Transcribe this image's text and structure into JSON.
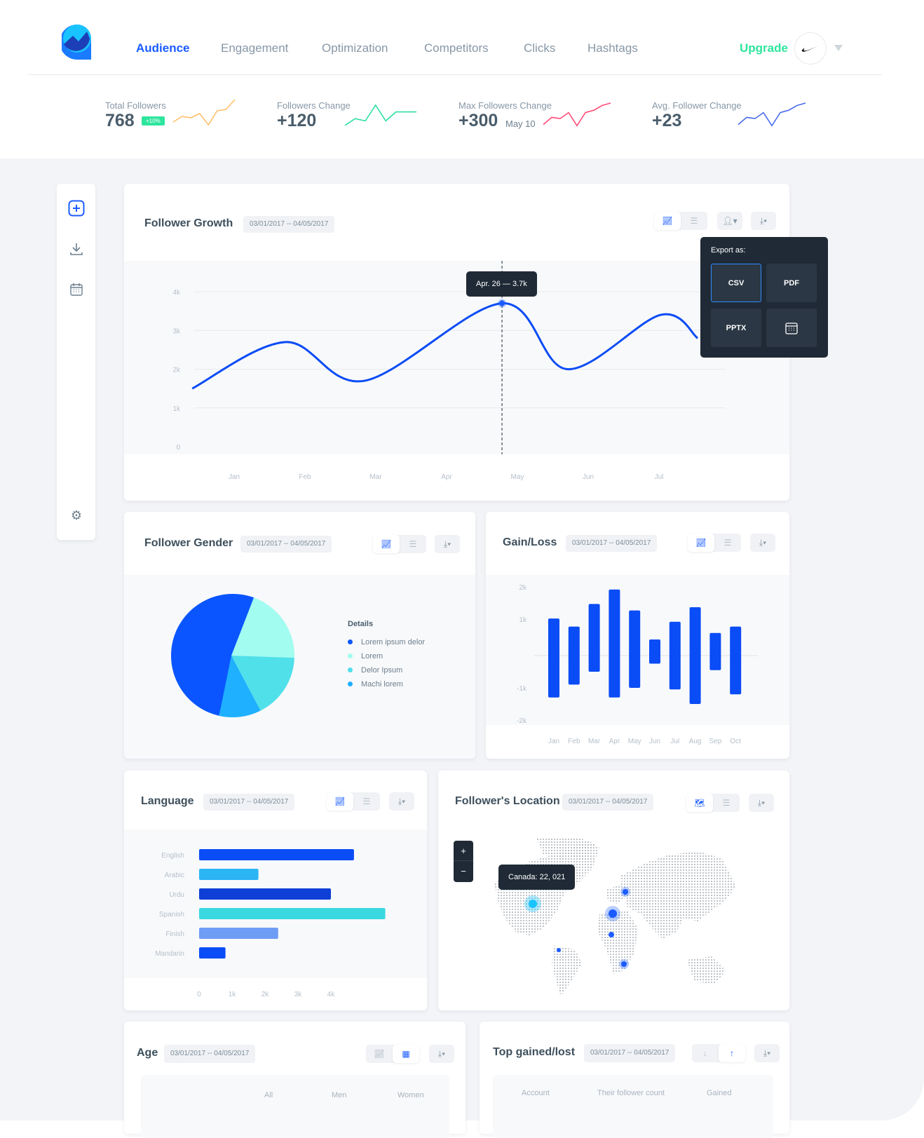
{
  "nav": {
    "items": [
      {
        "label": "Audience",
        "active": true
      },
      {
        "label": "Engagement"
      },
      {
        "label": "Optimization"
      },
      {
        "label": "Competitors"
      },
      {
        "label": "Clicks"
      },
      {
        "label": "Hashtags"
      }
    ],
    "upgrade_label": "Upgrade",
    "colors": {
      "accent": "#1a5cff",
      "upgrade": "#2ee59d"
    }
  },
  "kpis": [
    {
      "label": "Total Followers",
      "value": "768",
      "badge": "+10%",
      "color": "#ffc06b",
      "spark": [
        2,
        4,
        3.5,
        5,
        1,
        6,
        6.5,
        10
      ]
    },
    {
      "label": "Followers Change",
      "value": "+120",
      "color": "#2ee0a0",
      "spark": [
        1,
        4,
        3,
        10,
        3,
        7,
        7,
        7
      ]
    },
    {
      "label": "Max Followers Change",
      "value": "+300",
      "sub": "May 10",
      "color": "#ff4d7a",
      "spark": [
        1,
        4,
        3.5,
        6,
        0.5,
        6,
        7,
        9,
        10
      ]
    },
    {
      "label": "Avg. Follower Change",
      "value": "+23",
      "color": "#4a6cf0",
      "spark": [
        1,
        4,
        3.5,
        6,
        0.5,
        6,
        7,
        9,
        10
      ]
    }
  ],
  "sidebar": {
    "icons": [
      "add-icon",
      "download-icon",
      "calendar-icon",
      "gear-icon"
    ]
  },
  "follower_growth": {
    "title": "Follower Growth",
    "date": "03/01/2017 -- 04/05/2017",
    "tooltip": "Apr. 26  —  3.7k",
    "export": {
      "label": "Export as:",
      "options": [
        "CSV",
        "PDF",
        "PPTX"
      ]
    }
  },
  "follower_gender": {
    "title": "Follower Gender",
    "date": "03/01/2017 -- 04/05/2017",
    "details_label": "Details"
  },
  "gain_loss": {
    "title": "Gain/Loss",
    "date": "03/01/2017 -- 04/05/2017"
  },
  "language": {
    "title": "Language",
    "date": "03/01/2017 -- 04/05/2017"
  },
  "location": {
    "title": "Follower's Location",
    "date": "03/01/2017 -- 04/05/2017",
    "tooltip": "Canada: 22, 021",
    "zoom_in": "+",
    "zoom_out": "−"
  },
  "age": {
    "title": "Age",
    "date": "03/01/2017 -- 04/05/2017",
    "columns": [
      "All",
      "Men",
      "Women"
    ]
  },
  "top": {
    "title": "Top gained/lost",
    "date": "03/01/2017 -- 04/05/2017",
    "columns": [
      "Account",
      "Their follower count",
      "Gained"
    ]
  },
  "chart_data": [
    {
      "type": "line",
      "title": "Follower Growth",
      "x_ticks": [
        "Jan",
        "Feb",
        "Mar",
        "Apr",
        "May",
        "Jun",
        "Jul"
      ],
      "y_ticks": [
        "0",
        "1k",
        "2k",
        "3k",
        "4k"
      ],
      "ylim": [
        0,
        4000
      ],
      "series": [
        {
          "color": "#0a4cf5",
          "points": [
            {
              "x": "2016-12-14",
              "y": 1500
            },
            {
              "x": "2017-01-23",
              "y": 2700
            },
            {
              "x": "2017-02-26",
              "y": 1700
            },
            {
              "x": "2017-04-26",
              "y": 3700
            },
            {
              "x": "2017-05-24",
              "y": 2000
            },
            {
              "x": "2017-07-03",
              "y": 3400
            },
            {
              "x": "2017-07-19",
              "y": 2800
            }
          ]
        }
      ],
      "highlight": {
        "x": "2017-04-26",
        "y": 3700
      }
    },
    {
      "type": "pie",
      "title": "Follower Gender",
      "slices": [
        {
          "label": "Lorem ipsum delor",
          "value": 52,
          "color": "#0a55ff"
        },
        {
          "label": "Lorem",
          "value": 20,
          "color": "#a3fcf0"
        },
        {
          "label": "Delor Ipsum",
          "value": 17,
          "color": "#4fe0ea"
        },
        {
          "label": "Machi lorem",
          "value": 11,
          "color": "#1fb0ff"
        }
      ]
    },
    {
      "type": "bar",
      "title": "Gain/Loss",
      "categories": [
        "Jan",
        "Feb",
        "Mar",
        "Apr",
        "May",
        "Jun",
        "Jul",
        "Aug",
        "Sep",
        "Oct"
      ],
      "gain": [
        1150,
        900,
        1600,
        2050,
        1400,
        500,
        1050,
        1500,
        700,
        900
      ],
      "loss": [
        -1300,
        -900,
        -500,
        -1300,
        -1000,
        -250,
        -1050,
        -1500,
        -450,
        -1200
      ],
      "y_ticks": [
        "2k",
        "1k",
        "-1k",
        "-2k"
      ],
      "color": "#0a4cf5"
    },
    {
      "type": "bar",
      "orientation": "horizontal",
      "title": "Language",
      "categories": [
        "English",
        "Arabic",
        "Urdu",
        "Spanish",
        "Finish",
        "Mandarin"
      ],
      "values": [
        4700,
        1800,
        4000,
        5650,
        2400,
        800
      ],
      "colors": [
        "#0a4cf5",
        "#2bb5f5",
        "#0f3fd6",
        "#3ad8e0",
        "#6f9cf5",
        "#0a4cf5"
      ],
      "x_ticks": [
        "0",
        "1k",
        "2k",
        "3k",
        "4k"
      ]
    }
  ]
}
